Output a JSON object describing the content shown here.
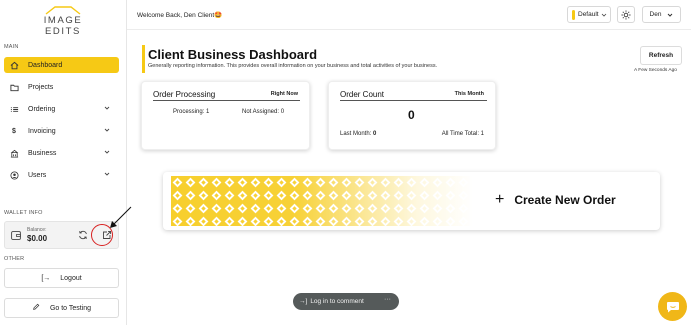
{
  "brand": {
    "logo_text": "IMAGE EDITS"
  },
  "sidebar": {
    "main_label": "MAIN",
    "items": [
      {
        "label": "Dashboard",
        "icon": "home-icon",
        "active": true
      },
      {
        "label": "Projects",
        "icon": "folder-icon"
      },
      {
        "label": "Ordering",
        "icon": "list-icon",
        "expandable": true
      },
      {
        "label": "Invoicing",
        "icon": "dollar-icon",
        "expandable": true
      },
      {
        "label": "Business",
        "icon": "building-icon",
        "expandable": true
      },
      {
        "label": "Users",
        "icon": "user-circle-icon",
        "expandable": true
      }
    ],
    "wallet_label": "WALLET INFO",
    "wallet": {
      "balance_label": "Balance:",
      "balance_value": "$0.00"
    },
    "other_label": "OTHER",
    "logout_label": "Logout",
    "testing_label": "Go to Testing"
  },
  "header": {
    "welcome": "Welcome Back, Den Client",
    "welcome_emoji": "🤩",
    "mode_select": "Default",
    "user_name": "Den"
  },
  "main": {
    "title": "Client Business Dashboard",
    "subtitle": "Generally reporting information. This provides overall information on your business and total activities of your business.",
    "refresh_label": "Refresh",
    "refresh_time": "A Few Seconds Ago",
    "order_processing": {
      "title": "Order Processing",
      "tag": "Right Now",
      "processing": "Processing: 1",
      "not_assigned": "Not Assigned: 0"
    },
    "order_count": {
      "title": "Order Count",
      "tag": "This Month",
      "value": "0",
      "last_month_label": "Last Month:",
      "last_month_value": "0",
      "all_time": "All Time Total: 1"
    },
    "create_order_label": "Create New Order"
  },
  "comment_bar": {
    "label": "Log in to comment",
    "more": "···"
  },
  "colors": {
    "accent": "#f6c915",
    "chat_button": "#f0b718",
    "annotation": "#d82020"
  }
}
